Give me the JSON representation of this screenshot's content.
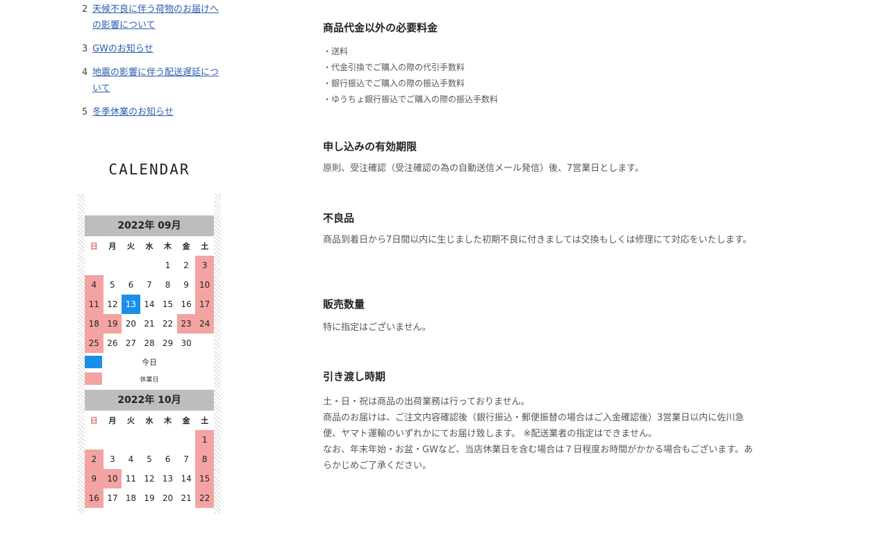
{
  "news": {
    "items": [
      {
        "num": "2",
        "text": "天候不良に伴う荷物のお届けへの影響について"
      },
      {
        "num": "3",
        "text": "GWのお知らせ"
      },
      {
        "num": "4",
        "text": "地震の影響に伴う配送遅延について"
      },
      {
        "num": "5",
        "text": "冬季休業のお知らせ"
      }
    ]
  },
  "calendar": {
    "title": "CALENDAR",
    "colors": {
      "holiday": "#f4a3a3",
      "today": "#1b8fe8",
      "header": "#bdbdbd"
    },
    "weekdays": [
      "日",
      "月",
      "火",
      "水",
      "木",
      "金",
      "土"
    ],
    "legend": {
      "today": "今日",
      "holiday": "休業日"
    },
    "months": [
      {
        "title": "2022年 09月",
        "weeks": [
          [
            {
              "d": ""
            },
            {
              "d": ""
            },
            {
              "d": ""
            },
            {
              "d": ""
            },
            {
              "d": "1"
            },
            {
              "d": "2"
            },
            {
              "d": "3",
              "t": "hol"
            }
          ],
          [
            {
              "d": "4",
              "t": "hol"
            },
            {
              "d": "5"
            },
            {
              "d": "6"
            },
            {
              "d": "7"
            },
            {
              "d": "8"
            },
            {
              "d": "9"
            },
            {
              "d": "10",
              "t": "hol"
            }
          ],
          [
            {
              "d": "11",
              "t": "hol"
            },
            {
              "d": "12"
            },
            {
              "d": "13",
              "t": "today"
            },
            {
              "d": "14"
            },
            {
              "d": "15"
            },
            {
              "d": "16"
            },
            {
              "d": "17",
              "t": "hol"
            }
          ],
          [
            {
              "d": "18",
              "t": "hol"
            },
            {
              "d": "19",
              "t": "hol"
            },
            {
              "d": "20"
            },
            {
              "d": "21"
            },
            {
              "d": "22"
            },
            {
              "d": "23",
              "t": "hol"
            },
            {
              "d": "24",
              "t": "hol"
            }
          ],
          [
            {
              "d": "25",
              "t": "hol"
            },
            {
              "d": "26"
            },
            {
              "d": "27"
            },
            {
              "d": "28"
            },
            {
              "d": "29"
            },
            {
              "d": "30"
            },
            {
              "d": ""
            }
          ]
        ]
      },
      {
        "title": "2022年 10月",
        "weeks": [
          [
            {
              "d": ""
            },
            {
              "d": ""
            },
            {
              "d": ""
            },
            {
              "d": ""
            },
            {
              "d": ""
            },
            {
              "d": ""
            },
            {
              "d": "1",
              "t": "hol"
            }
          ],
          [
            {
              "d": "2",
              "t": "hol"
            },
            {
              "d": "3"
            },
            {
              "d": "4"
            },
            {
              "d": "5"
            },
            {
              "d": "6"
            },
            {
              "d": "7"
            },
            {
              "d": "8",
              "t": "hol"
            }
          ],
          [
            {
              "d": "9",
              "t": "hol"
            },
            {
              "d": "10",
              "t": "hol"
            },
            {
              "d": "11"
            },
            {
              "d": "12"
            },
            {
              "d": "13"
            },
            {
              "d": "14"
            },
            {
              "d": "15",
              "t": "hol"
            }
          ],
          [
            {
              "d": "16",
              "t": "hol"
            },
            {
              "d": "17"
            },
            {
              "d": "18"
            },
            {
              "d": "19"
            },
            {
              "d": "20"
            },
            {
              "d": "21"
            },
            {
              "d": "22",
              "t": "hol"
            }
          ]
        ]
      }
    ]
  },
  "content": {
    "sections": [
      {
        "heading": "商品代金以外の必要料金",
        "list": [
          "・送料",
          "・代金引換でご購入の際の代引手数料",
          "・銀行振込でご購入の際の振込手数料",
          "・ゆうちょ銀行振込でご購入の際の振込手数料"
        ]
      },
      {
        "heading": "申し込みの有効期限",
        "paragraphs": [
          "原則、受注確認（受注確認の為の自動送信メール発信）後、7営業日とします。"
        ]
      },
      {
        "heading": "不良品",
        "paragraphs": [
          "商品到着日から7日間以内に生じました初期不良に付きましては交換もしくは修理にて対応をいたします。"
        ]
      },
      {
        "heading": "販売数量",
        "paragraphs": [
          "特に指定はございません。"
        ]
      },
      {
        "heading": "引き渡し時期",
        "paragraphs": [
          "土・日・祝は商品の出荷業務は行っておりません。",
          "商品のお届けは、ご注文内容確認後（銀行振込・郵便振替の場合はご入金確認後）3営業日以内に佐川急便、ヤマト運輸のいずれかにてお届け致します。 ※配送業者の指定はできません。",
          "なお、年末年始・お盆・GWなど、当店休業日を含む場合は７日程度お時間がかかる場合もございます。あらかじめご了承ください。"
        ]
      }
    ]
  }
}
